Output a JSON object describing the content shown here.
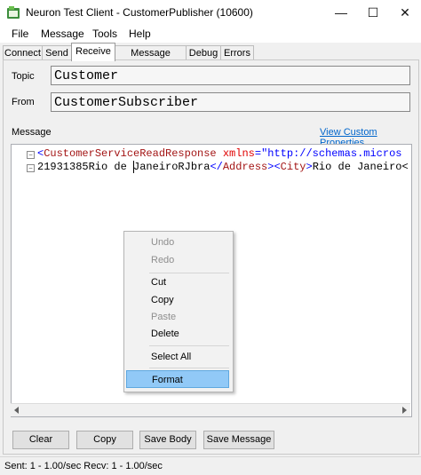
{
  "window": {
    "title": "Neuron Test Client - CustomerPublisher (10600)",
    "icon": "neuron-app-icon",
    "minimize_glyph": "—",
    "maximize_glyph": "☐",
    "close_glyph": "✕"
  },
  "menu": [
    "File",
    "Message",
    "Tools",
    "Help"
  ],
  "tabs": [
    {
      "label": "Connect"
    },
    {
      "label": "Send"
    },
    {
      "label": "Receive",
      "active": true
    },
    {
      "label": "Message History"
    },
    {
      "label": "Debug"
    },
    {
      "label": "Errors"
    }
  ],
  "receive": {
    "topic_label": "Topic",
    "topic_value": "Customer",
    "from_label": "From",
    "from_value": "CustomerSubscriber",
    "message_label": "Message",
    "custom_props_link": "View Custom Properties",
    "editor_lines": [
      {
        "fold": "-",
        "segments": [
          {
            "text": "<",
            "cls": "punc"
          },
          {
            "text": "CustomerServiceReadResponse",
            "cls": "tag"
          },
          {
            "text": " xmlns",
            "cls": "attr"
          },
          {
            "text": "=",
            "cls": "punc"
          },
          {
            "text": "\"http://schemas.micros",
            "cls": "str"
          }
        ]
      },
      {
        "fold": "-",
        "segments": [
          {
            "text": "21931385Rio de JaneiroRJbra",
            "cls": ""
          },
          {
            "text": "</",
            "cls": "punc"
          },
          {
            "text": "Address",
            "cls": "tag"
          },
          {
            "text": "><",
            "cls": "punc"
          },
          {
            "text": "City",
            "cls": "tag"
          },
          {
            "text": ">",
            "cls": "punc"
          },
          {
            "text": "Rio de Janeiro<",
            "cls": ""
          }
        ]
      }
    ]
  },
  "context_menu": [
    {
      "label": "Undo",
      "disabled": true
    },
    {
      "label": "Redo",
      "disabled": true
    },
    {
      "separator": true
    },
    {
      "label": "Cut"
    },
    {
      "label": "Copy"
    },
    {
      "label": "Paste",
      "disabled": true
    },
    {
      "label": "Delete"
    },
    {
      "separator": true
    },
    {
      "label": "Select All"
    },
    {
      "separator": true
    },
    {
      "label": "Format",
      "highlighted": true
    }
  ],
  "buttons": {
    "clear": "Clear",
    "copy": "Copy",
    "save_body": "Save Body",
    "save_message": "Save Message"
  },
  "status": {
    "text": "Sent: 1  -  1.00/sec  Recv: 1  -  1.00/sec"
  },
  "colors": {
    "xml_tag": "#a31515",
    "xml_attr": "#e00000",
    "xml_string": "#0000ff",
    "context_highlight": "#91c9f7",
    "link": "#0066cc"
  }
}
